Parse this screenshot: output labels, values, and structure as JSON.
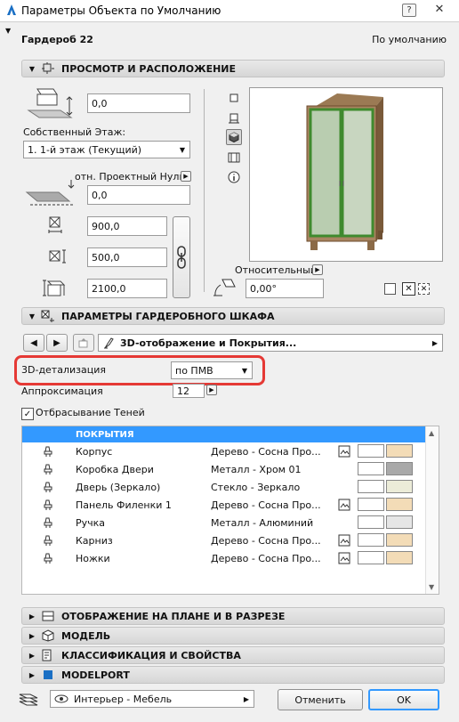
{
  "window": {
    "title": "Параметры Объекта по Умолчанию",
    "close": "✕",
    "help": "?"
  },
  "header": {
    "object_name": "Гардероб 22",
    "default_label": "По умолчанию"
  },
  "sections": {
    "view": "ПРОСМОТР И РАСПОЛОЖЕНИЕ",
    "wardrobe": "ПАРАМЕТРЫ ГАРДЕРОБНОГО ШКАФА",
    "plan": "ОТОБРАЖЕНИЕ НА ПЛАНЕ И В РАЗРЕЗЕ",
    "model": "МОДЕЛЬ",
    "classification": "КЛАССИФИКАЦИЯ И СВОЙСТВА",
    "modelport": "MODELPORT"
  },
  "placement": {
    "elevation_value": "0,0",
    "own_floor_label": "Собственный Этаж:",
    "own_floor_value": "1. 1-й этаж (Текущий)",
    "project_zero_label": "отн. Проектный Нуль",
    "project_zero_value": "0,0",
    "width": "900,0",
    "depth": "500,0",
    "height": "2100,0",
    "relative_label": "Относительный",
    "angle": "0,00°"
  },
  "wardrobe_params": {
    "page_label": "3D-отображение и Покрытия...",
    "detail_label": "3D-детализация",
    "detail_value": "по ПМВ",
    "approx_label": "Аппроксимация",
    "approx_value": "12",
    "shadows_label": "Отбрасывание Теней",
    "shadows_checked": true,
    "table_header": "ПОКРЫТИЯ",
    "rows": [
      {
        "name": "Корпус",
        "material": "Дерево - Сосна Про...",
        "texture": true,
        "swatch": "#f3dcb7"
      },
      {
        "name": "Коробка Двери",
        "material": "Металл - Хром 01",
        "texture": false,
        "swatch": "#a9a9a9"
      },
      {
        "name": "Дверь (Зеркало)",
        "material": "Стекло - Зеркало",
        "texture": false,
        "swatch": "#ececd8"
      },
      {
        "name": "Панель Филенки 1",
        "material": "Дерево - Сосна Про...",
        "texture": true,
        "swatch": "#f3dcb7"
      },
      {
        "name": "Ручка",
        "material": "Металл - Алюминий",
        "texture": false,
        "swatch": "#e6e6e6"
      },
      {
        "name": "Карниз",
        "material": "Дерево - Сосна Про...",
        "texture": true,
        "swatch": "#f3dcb7"
      },
      {
        "name": "Ножки",
        "material": "Дерево - Сосна Про...",
        "texture": true,
        "swatch": "#f3dcb7"
      }
    ]
  },
  "footer": {
    "layer": "Интерьер - Мебель",
    "cancel": "Отменить",
    "ok": "OK"
  },
  "colors": {
    "accent": "#3399ff",
    "highlight": "#e53935",
    "wood": "#8b6a47",
    "glass": "#b8d0b0",
    "frame": "#4a8a3a"
  }
}
